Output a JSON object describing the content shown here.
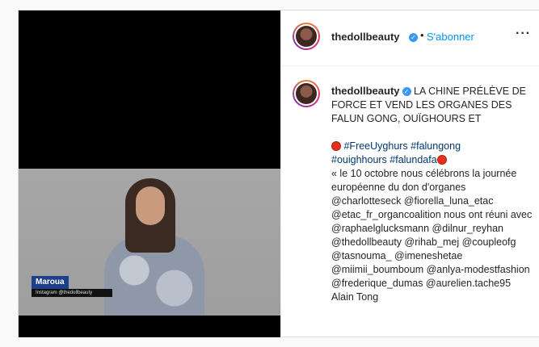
{
  "post": {
    "media": {
      "lower_third": {
        "name": "Maroua",
        "subtitle": "Instagram @thedollbeauty"
      }
    },
    "header": {
      "username": "thedollbeauty",
      "separator": "•",
      "follow_label": "S'abonner",
      "more_label": "···"
    },
    "caption": {
      "username": "thedollbeauty",
      "headline": "LA CHINE PRÉLÈVE DE FORCE ET VEND LES ORGANES DES FALUN GONG, OUÏGHOURS ET",
      "hashtags_line1": "#FreeUyghurs #falungong",
      "hashtags_line2": "#ouighhours #falundafa",
      "body": "« le 10 octobre nous célébrons la journée européenne du don d'organes @charlotteseck @fiorella_luna_etac @etac_fr_organcoalition nous ont réuni avec @raphaelglucksmann @dilnur_reyhan @thedollbeauty @rihab_mej @coupleofg @tasnouma_ @imeneshetae @miimii_boumboum @anlya-modestfashion @frederique_dumas @aurelien.tache95 Alain Tong"
    }
  },
  "colors": {
    "follow": "#0095f6",
    "verified": "#3897f0",
    "lower_third": "#1d3f8a",
    "emoji_dot": "#e3311c"
  },
  "icons": {
    "verified": "verified-badge-icon",
    "emoji": "red-circle-emoji-icon"
  }
}
